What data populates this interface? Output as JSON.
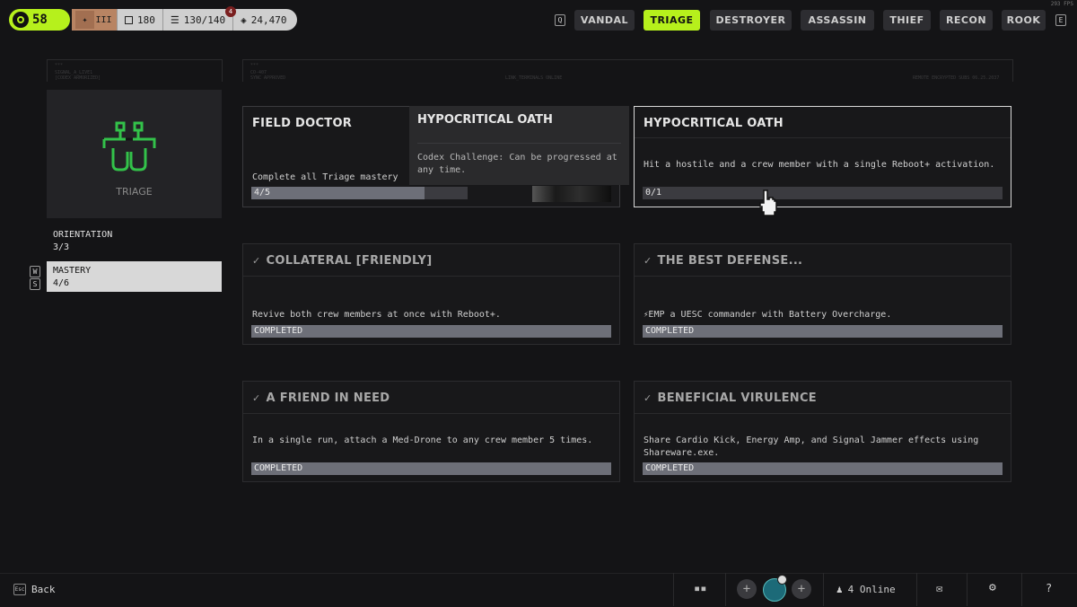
{
  "topbar": {
    "level": "58",
    "rank_numeral": "III",
    "stat1": "180",
    "capacity": "130/140",
    "capacity_badge": "4",
    "currency": "24,470",
    "key_left": "Q",
    "key_right": "E",
    "tabs": [
      "VANDAL",
      "TRIAGE",
      "DESTROYER",
      "ASSASSIN",
      "THIEF",
      "RECON",
      "ROOK"
    ],
    "active_tab": "TRIAGE",
    "fps": "293 FPS",
    "accent_color": "#b6f01c"
  },
  "left_panel": {
    "icon_label": "TRIAGE",
    "items": [
      {
        "label": "ORIENTATION",
        "value": "3/3"
      },
      {
        "label": "MASTERY",
        "value": "4/6"
      }
    ],
    "nav_keys": [
      "W",
      "S"
    ]
  },
  "cards": [
    {
      "title": "FIELD DOCTOR",
      "desc": "Complete all Triage mastery",
      "progress": "4/5",
      "progress_fraction": 0.8,
      "completed": false
    },
    {
      "title": "HYPOCRITICAL OATH",
      "desc": "Hit a hostile and a crew member with a single Reboot+ activation.",
      "progress": "0/1",
      "progress_fraction": 0,
      "completed": false
    },
    {
      "title": "COLLATERAL [FRIENDLY]",
      "desc": "Revive both crew members at once with Reboot+.",
      "status": "COMPLETED",
      "completed": true
    },
    {
      "title": "THE BEST DEFENSE...",
      "desc": "EMP a UESC commander with Battery Overcharge.",
      "status": "COMPLETED",
      "completed": true
    },
    {
      "title": "A FRIEND IN NEED",
      "desc": "In a single run, attach a Med-Drone to any crew member 5 times.",
      "status": "COMPLETED",
      "completed": true
    },
    {
      "title": "BENEFICIAL VIRULENCE",
      "desc": "Share Cardio Kick, Energy Amp, and Signal Jammer effects using Shareware.exe.",
      "status": "COMPLETED",
      "completed": true
    }
  ],
  "tooltip": {
    "title": "HYPOCRITICAL OATH",
    "desc": "Codex Challenge: Can be progressed at any time."
  },
  "bottombar": {
    "back_key": "Esc",
    "back_label": "Back",
    "online": "4 Online"
  },
  "header_text": {
    "box1_line1": "***",
    "box1_line2": "SIGNAL_A_LIVE1",
    "box1_line3": "[CODEX ARMORIZED]",
    "box2_line1": "***",
    "box2_line2": "CO-407",
    "box2_line3": "SYNC APPROVED",
    "box2_mid": "LINK_TERMINALS ONLINE",
    "box2_right": "REMOTE ENCRYPTED SUBS 06.25.2037"
  }
}
